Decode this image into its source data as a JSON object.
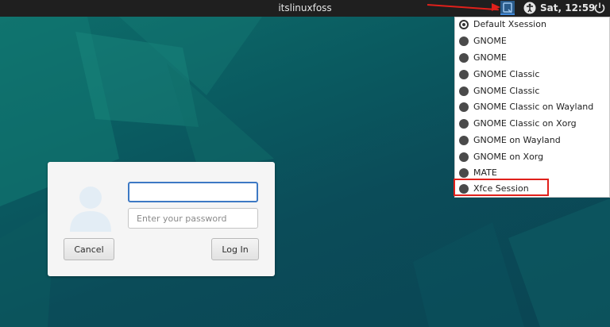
{
  "topbar": {
    "hostname": "itslinuxfoss",
    "clock": "Sat, 12:59",
    "icons": [
      "session-icon",
      "accessibility-icon",
      "power-icon"
    ]
  },
  "session_menu": {
    "items": [
      {
        "label": "Default Xsession",
        "selected": true
      },
      {
        "label": "GNOME",
        "selected": false
      },
      {
        "label": "GNOME",
        "selected": false
      },
      {
        "label": "GNOME Classic",
        "selected": false
      },
      {
        "label": "GNOME Classic",
        "selected": false
      },
      {
        "label": "GNOME Classic on Wayland",
        "selected": false
      },
      {
        "label": "GNOME Classic on Xorg",
        "selected": false
      },
      {
        "label": "GNOME on Wayland",
        "selected": false
      },
      {
        "label": "GNOME on Xorg",
        "selected": false
      },
      {
        "label": "MATE",
        "selected": false
      },
      {
        "label": "Xfce Session",
        "selected": false,
        "highlighted": true
      }
    ]
  },
  "login": {
    "username_value": "",
    "password_placeholder": "Enter your password",
    "cancel_label": "Cancel",
    "login_label": "Log In"
  },
  "colors": {
    "annotation": "#e0201b",
    "focus": "#3d79c4"
  }
}
